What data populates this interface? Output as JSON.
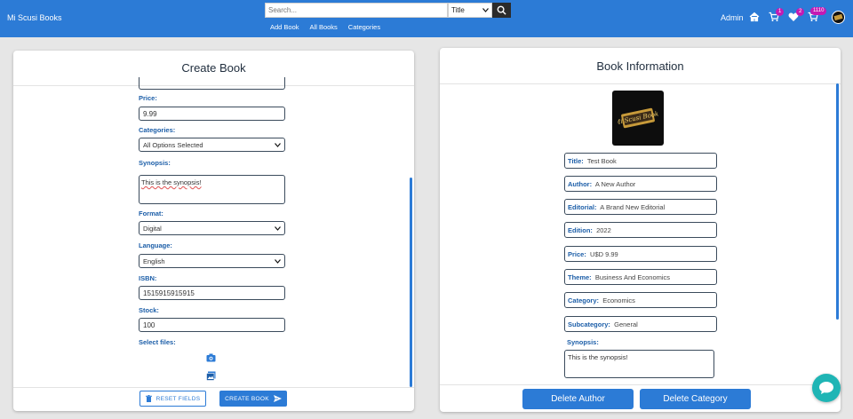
{
  "header": {
    "brand": "Mi Scusi Books",
    "search_placeholder": "Search...",
    "search_type": "Title",
    "nav": [
      "Add Book",
      "All Books",
      "Categories"
    ],
    "user": "Admin",
    "cart_count": "1",
    "wishlist_count": "2",
    "orders_count": "1110"
  },
  "create": {
    "title": "Create Book",
    "price_label": "Price:",
    "price_value": "9.99",
    "categories_label": "Categories:",
    "categories_value": "All Options Selected",
    "synopsis_label": "Synopsis:",
    "synopsis_value": "This is the synopsis!",
    "format_label": "Format:",
    "format_value": "Digital",
    "language_label": "Language:",
    "language_value": "English",
    "isbn_label": "ISBN:",
    "isbn_value": "1515915915915",
    "stock_label": "Stock:",
    "stock_value": "100",
    "files_label": "Select files:",
    "reset_label": "RESET FIELDS",
    "create_label": "CREATE BOOK"
  },
  "info": {
    "title": "Book Information",
    "logo_text": "Mi Scusi Books",
    "fields": [
      {
        "label": "Title:",
        "value": "Test Book"
      },
      {
        "label": "Author:",
        "value": "A New Author"
      },
      {
        "label": "Editorial:",
        "value": "A Brand New Editorial"
      },
      {
        "label": "Edition:",
        "value": "2022"
      },
      {
        "label": "Price:",
        "value": "U$D 9.99"
      },
      {
        "label": "Theme:",
        "value": "Business And Economics"
      },
      {
        "label": "Category:",
        "value": "Economics"
      },
      {
        "label": "Subcategory:",
        "value": "General"
      }
    ],
    "synopsis_label": "Synopsis:",
    "synopsis_value": "This is the synopsis!",
    "delete_author": "Delete Author",
    "delete_category": "Delete Category"
  },
  "colors": {
    "primary": "#2c7bd6",
    "label": "#1c5ea8",
    "badge": "#c41ab3",
    "chat": "#1fb5b5"
  }
}
